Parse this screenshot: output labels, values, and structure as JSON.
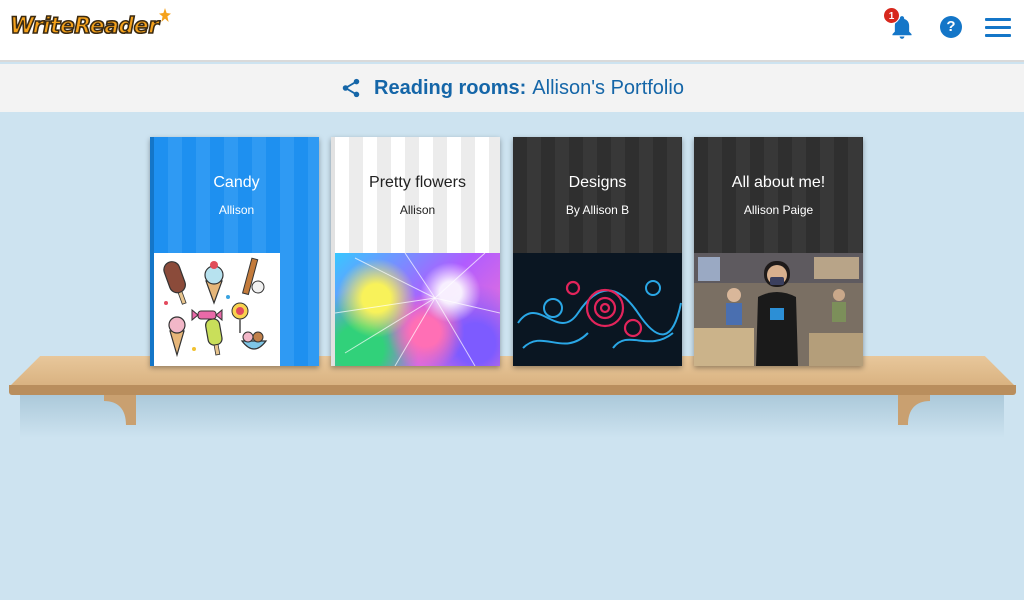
{
  "header": {
    "logo_text": "WriteReader",
    "notification_count": "1",
    "help_glyph": "?",
    "icons": [
      "bell-icon",
      "help-icon",
      "hamburger-menu-icon"
    ],
    "accent_color": "#1476c8"
  },
  "subheader": {
    "label": "Reading rooms:",
    "name": "Allison's Portfolio",
    "icon": "share-icon"
  },
  "books": [
    {
      "title": "Candy",
      "author": "Allison",
      "cover_color": "#1e90f0"
    },
    {
      "title": "Pretty flowers",
      "author": "Allison",
      "cover_color": "#ffffff"
    },
    {
      "title": "Designs",
      "author": "By Allison B",
      "cover_color": "#2f2f2f"
    },
    {
      "title": "All about me!",
      "author": "Allison Paige",
      "cover_color": "#2f2f2f"
    }
  ]
}
